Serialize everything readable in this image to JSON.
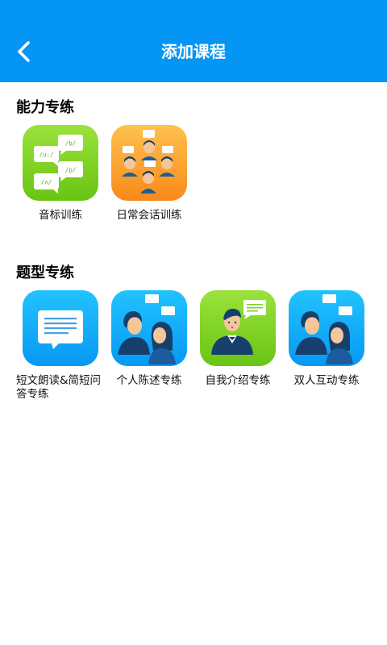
{
  "header": {
    "title": "添加课程"
  },
  "sections": [
    {
      "title": "能力专练",
      "items": [
        {
          "label": "音标训练",
          "icon": "phonetic-bubbles-icon",
          "phonetics": [
            "/b/",
            "/u:/",
            "/p/",
            "/ʌ/"
          ]
        },
        {
          "label": "日常会话训练",
          "icon": "group-conversation-icon"
        }
      ]
    },
    {
      "title": "题型专练",
      "items": [
        {
          "label": "短文朗读&简短问答专练",
          "icon": "message-text-icon"
        },
        {
          "label": "个人陈述专练",
          "icon": "two-person-dialog-icon"
        },
        {
          "label": "自我介绍专练",
          "icon": "self-introduction-icon"
        },
        {
          "label": "双人互动专练",
          "icon": "two-person-interaction-icon"
        }
      ]
    }
  ],
  "colors": {
    "header": "#0595f4",
    "green": "#7bd21f",
    "orange": "#f99b24",
    "blue": "#13acf8",
    "navy": "#173f6d"
  }
}
